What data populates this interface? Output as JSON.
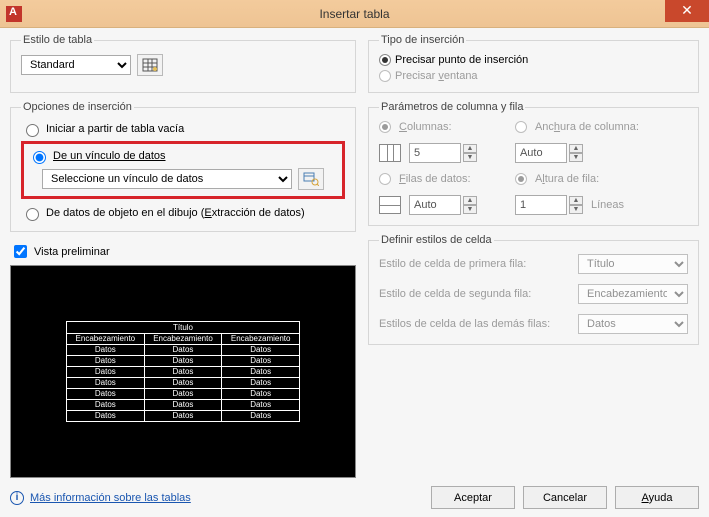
{
  "window": {
    "title": "Insertar tabla",
    "close": "✕"
  },
  "style": {
    "legend": "Estilo de tabla",
    "value": "Standard"
  },
  "insert_options": {
    "legend": "Opciones de inserción",
    "empty": "Iniciar a partir de tabla vacía",
    "datalink": "De un vínculo de datos",
    "datalink_select": "Seleccione un vínculo de datos",
    "object_prefix": "De datos de objeto en el dibujo (",
    "object_underline": "E",
    "object_suffix": "xtracción de datos)"
  },
  "preview_label": "Vista preliminar",
  "preview": {
    "title": "Título",
    "headers": [
      "Encabezamiento",
      "Encabezamiento",
      "Encabezamiento"
    ],
    "cell": "Datos",
    "rows": 7,
    "cols": 3
  },
  "insertion_type": {
    "legend": "Tipo de inserción",
    "point": "Precisar punto de inserción",
    "window_prefix": "Precisar ",
    "window_underline": "v",
    "window_suffix": "entana"
  },
  "col_params": {
    "legend": "Parámetros de columna y fila",
    "columns_underline": "C",
    "columns_suffix": "olumnas:",
    "columns_value": "5",
    "width_prefix": "Anc",
    "width_underline": "h",
    "width_suffix": "ura de columna:",
    "width_value": "Auto",
    "rows_underline": "F",
    "rows_suffix": "ilas de datos:",
    "rows_value": "Auto",
    "height_prefix": "A",
    "height_underline": "l",
    "height_suffix": "tura de fila:",
    "height_value": "1",
    "lines": "Líneas"
  },
  "cell_styles": {
    "legend": "Definir estilos de celda",
    "row1": "Estilo de celda de primera fila:",
    "row1_val": "Título",
    "row2": "Estilo de celda de segunda fila:",
    "row2_val": "Encabezamiento",
    "rest": "Estilos de celda de las demás filas:",
    "rest_val": "Datos"
  },
  "footer": {
    "more_info": "Más información sobre las tablas",
    "accept": "Aceptar",
    "cancel": "Cancelar",
    "help_underline": "A",
    "help_suffix": "yuda"
  }
}
